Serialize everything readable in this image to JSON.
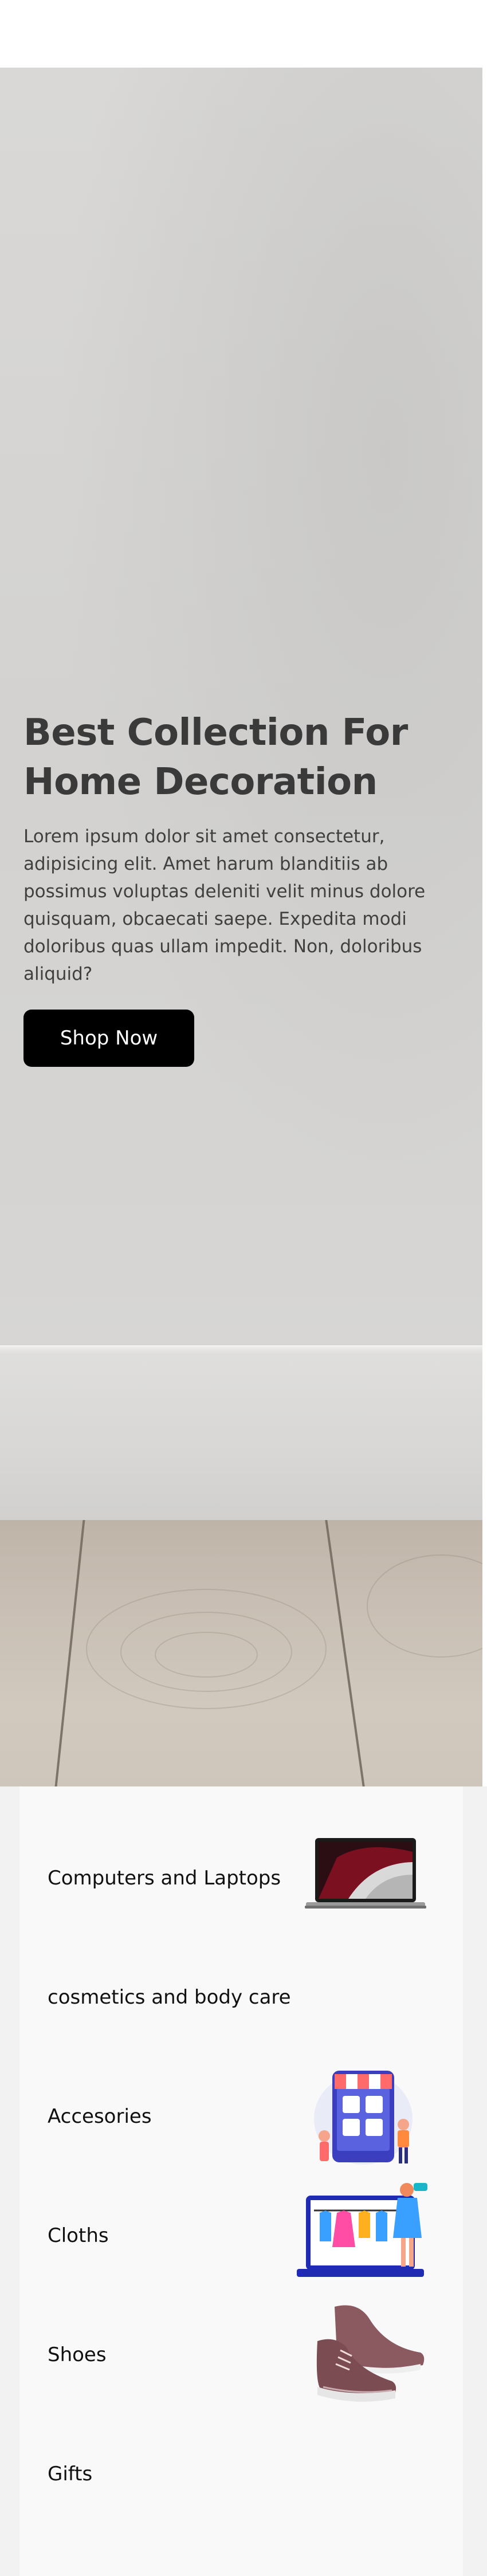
{
  "hero": {
    "title_line1": "Best Collection For",
    "title_line2": "Home Decoration",
    "description": "Lorem ipsum dolor sit amet consectetur, adipisicing elit. Amet harum blanditiis ab possimus voluptas deleniti velit minus dolore quisquam, obcaecati saepe. Expedita modi doloribus quas ullam impedit. Non, doloribus aliquid?",
    "button_label": "Shop Now"
  },
  "categories": [
    {
      "label": "Computers and Laptops",
      "icon": "laptop-icon"
    },
    {
      "label": "cosmetics and body care",
      "icon": ""
    },
    {
      "label": "Accesories",
      "icon": "online-store-icon"
    },
    {
      "label": "Cloths",
      "icon": "clothing-shop-icon"
    },
    {
      "label": "Shoes",
      "icon": "sneaker-icon"
    },
    {
      "label": "Gifts",
      "icon": ""
    }
  ],
  "colors": {
    "button_bg": "#000000",
    "button_text": "#ffffff",
    "title_text": "#3a3a3a",
    "panel_bg": "#faf9f9"
  }
}
